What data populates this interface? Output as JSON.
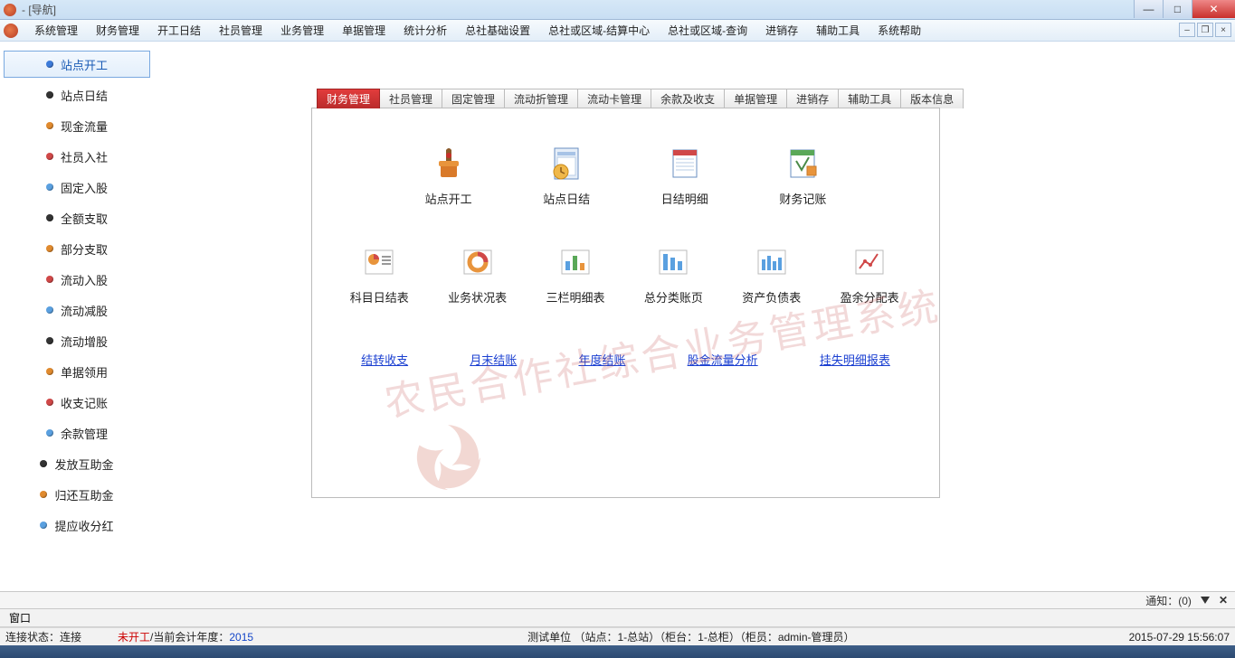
{
  "titlebar": {
    "title": " - [导航]"
  },
  "menubar": {
    "items": [
      "系统管理",
      "财务管理",
      "开工日结",
      "社员管理",
      "业务管理",
      "单据管理",
      "统计分析",
      "总社基础设置",
      "总社或区域-结算中心",
      "总社或区域-查询",
      "进销存",
      "辅助工具",
      "系统帮助"
    ]
  },
  "sidebar": {
    "items": [
      {
        "label": "站点开工",
        "color": "#3d7bd9",
        "active": true
      },
      {
        "label": "站点日结",
        "color": "#333333"
      },
      {
        "label": "现金流量",
        "color": "#e08a2e"
      },
      {
        "label": "社员入社",
        "color": "#d04848"
      },
      {
        "label": "固定入股",
        "color": "#5aa0e0"
      },
      {
        "label": "全额支取",
        "color": "#333333"
      },
      {
        "label": "部分支取",
        "color": "#e08a2e"
      },
      {
        "label": "流动入股",
        "color": "#d04848"
      },
      {
        "label": "流动减股",
        "color": "#5aa0e0"
      },
      {
        "label": "流动增股",
        "color": "#333333"
      },
      {
        "label": "单据领用",
        "color": "#e08a2e"
      },
      {
        "label": "收支记账",
        "color": "#d04848"
      },
      {
        "label": "余款管理",
        "color": "#5aa0e0"
      },
      {
        "label": "发放互助金",
        "color": "#333333"
      },
      {
        "label": "归还互助金",
        "color": "#e08a2e"
      },
      {
        "label": "提应收分红",
        "color": "#5aa0e0"
      }
    ]
  },
  "tabs": [
    "财务管理",
    "社员管理",
    "固定管理",
    "流动折管理",
    "流动卡管理",
    "余款及收支",
    "单据管理",
    "进销存",
    "辅助工具",
    "版本信息"
  ],
  "panel": {
    "icons_row1": [
      {
        "label": "站点开工",
        "name": "site-open-icon"
      },
      {
        "label": "站点日结",
        "name": "site-close-icon"
      },
      {
        "label": "日结明细",
        "name": "daily-detail-icon"
      },
      {
        "label": "财务记账",
        "name": "finance-book-icon"
      }
    ],
    "icons_row2": [
      {
        "label": "科目日结表",
        "name": "subject-daily-icon"
      },
      {
        "label": "业务状况表",
        "name": "business-status-icon"
      },
      {
        "label": "三栏明细表",
        "name": "three-col-detail-icon"
      },
      {
        "label": "总分类账页",
        "name": "general-ledger-icon"
      },
      {
        "label": "资产负债表",
        "name": "balance-sheet-icon"
      },
      {
        "label": "盈余分配表",
        "name": "surplus-dist-icon"
      }
    ],
    "links": [
      "结转收支",
      "月末结账",
      "年度结账",
      "股金流量分析",
      "挂失明细报表"
    ]
  },
  "watermark": "农民合作社综合业务管理系统",
  "notify": {
    "text": "通知：(0)"
  },
  "winmenu": {
    "label": "窗口"
  },
  "status": {
    "conn": "连接状态：连接",
    "work": "未开工",
    "year_label": "/当前会计年度：",
    "year": "2015",
    "org": "测试单位 （站点：1-总站）（柜台：1-总柜）（柜员：admin-管理员）",
    "time": "2015-07-29 15:56:07"
  }
}
